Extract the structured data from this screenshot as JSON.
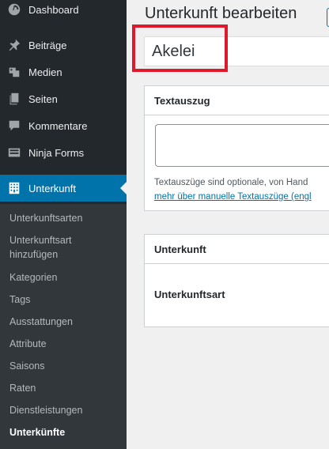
{
  "sidebar": {
    "items": [
      {
        "label": "Dashboard",
        "icon": "dashboard-icon"
      },
      {
        "label": "Beiträge",
        "icon": "pin-icon"
      },
      {
        "label": "Medien",
        "icon": "media-icon"
      },
      {
        "label": "Seiten",
        "icon": "pages-icon"
      },
      {
        "label": "Kommentare",
        "icon": "comment-icon"
      },
      {
        "label": "Ninja Forms",
        "icon": "forms-icon"
      },
      {
        "label": "Unterkunft",
        "icon": "building-icon",
        "active": true
      }
    ],
    "submenu": [
      {
        "label": "Unterkunftsarten"
      },
      {
        "label": "Unterkunftsart hinzufügen"
      },
      {
        "label": "Kategorien"
      },
      {
        "label": "Tags"
      },
      {
        "label": "Ausstattungen"
      },
      {
        "label": "Attribute"
      },
      {
        "label": "Saisons"
      },
      {
        "label": "Raten"
      },
      {
        "label": "Dienstleistungen"
      },
      {
        "label": "Unterkünfte",
        "current": true
      }
    ]
  },
  "main": {
    "page_title": "Unterkunft bearbeiten",
    "title_value": "Akelei",
    "excerpt_box": {
      "heading": "Textauszug",
      "help_text": "Textauszüge sind optionale, von Hand",
      "help_link": "mehr über manuelle Textauszüge (engl"
    },
    "unterkunft_box": {
      "heading": "Unterkunft",
      "field_label": "Unterkunftsart"
    }
  },
  "colors": {
    "sidebar_bg": "#23282d",
    "submenu_bg": "#32373c",
    "active_bg": "#0073aa",
    "highlight": "#e0182b"
  }
}
